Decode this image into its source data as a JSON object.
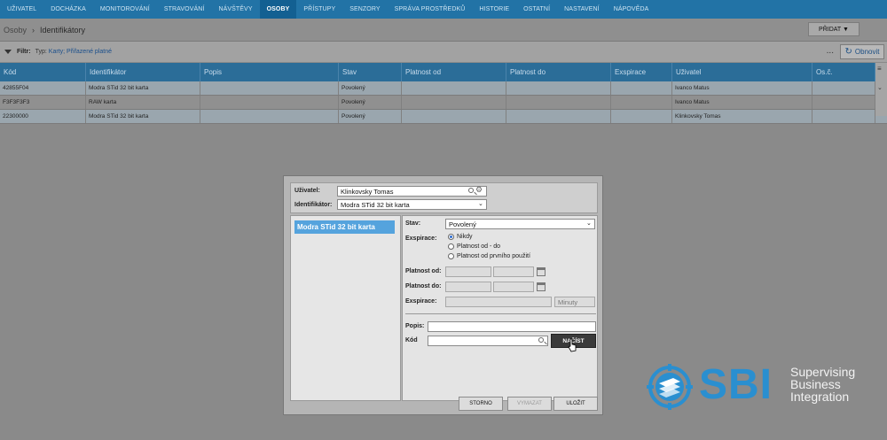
{
  "nav": {
    "items": [
      "UŽIVATEL",
      "DOCHÁZKA",
      "MONITOROVÁNÍ",
      "STRAVOVÁNÍ",
      "NÁVŠTĚVY",
      "OSOBY",
      "PŘÍSTUPY",
      "SENZORY",
      "SPRÁVA PROSTŘEDKŮ",
      "HISTORIE",
      "OSTATNÍ",
      "NASTAVENÍ",
      "NÁPOVĚDA"
    ],
    "active": "OSOBY"
  },
  "breadcrumb": {
    "root": "Osoby",
    "current": "Identifikátory"
  },
  "add_button": "PŘIDAT ▼",
  "filter": {
    "label": "Filtr:",
    "prefix": "Typ:",
    "value": "Karty; Přiřazené platné"
  },
  "refresh_button": "Obnovit",
  "more_label": "...",
  "table": {
    "columns": [
      "Kód",
      "Identifikátor",
      "Popis",
      "Stav",
      "Platnost od",
      "Platnost do",
      "Exspirace",
      "Uživatel",
      "Os.č."
    ],
    "rows": [
      {
        "kod": "42855F04",
        "identifikator": "Modra STid 32 bit karta",
        "popis": "",
        "stav": "Povolený",
        "od": "",
        "do": "",
        "exspirace": "",
        "uzivatel": "Ivanco Matus",
        "osc": ""
      },
      {
        "kod": "F3F3F3F3",
        "identifikator": "RAW karta",
        "popis": "",
        "stav": "Povolený",
        "od": "",
        "do": "",
        "exspirace": "",
        "uzivatel": "Ivanco Matus",
        "osc": ""
      },
      {
        "kod": "22300000",
        "identifikator": "Modra STid 32 bit karta",
        "popis": "",
        "stav": "Povolený",
        "od": "",
        "do": "",
        "exspirace": "",
        "uzivatel": "Klinkovsky Tomas",
        "osc": ""
      }
    ]
  },
  "dialog": {
    "user_label": "Uživatel:",
    "user_value": "Klinkovsky Tomas",
    "ident_label": "Identifikátor:",
    "ident_value": "Modra STid 32 bit karta",
    "list_item": "Modra STid 32 bit karta",
    "stav_label": "Stav:",
    "stav_value": "Povolený",
    "expirace_label": "Exspirace:",
    "radio_never": "Nikdy",
    "radio_range": "Platnost od - do",
    "radio_first": "Platnost od prvního použití",
    "platnost_od_label": "Platnost od:",
    "platnost_do_label": "Platnost do:",
    "exspirace2_label": "Exspirace:",
    "minuty": "Minuty",
    "popis_label": "Popis:",
    "kod_label": "Kód",
    "nacist": "NAČÍST",
    "storno": "STORNO",
    "vymazat": "VYMAZAT",
    "ulozit": "ULOŽIT"
  },
  "logo": {
    "brand": "SBI",
    "line1": "Supervising",
    "line2": "Business",
    "line3": "Integration",
    "color": "#2a8fd0"
  }
}
